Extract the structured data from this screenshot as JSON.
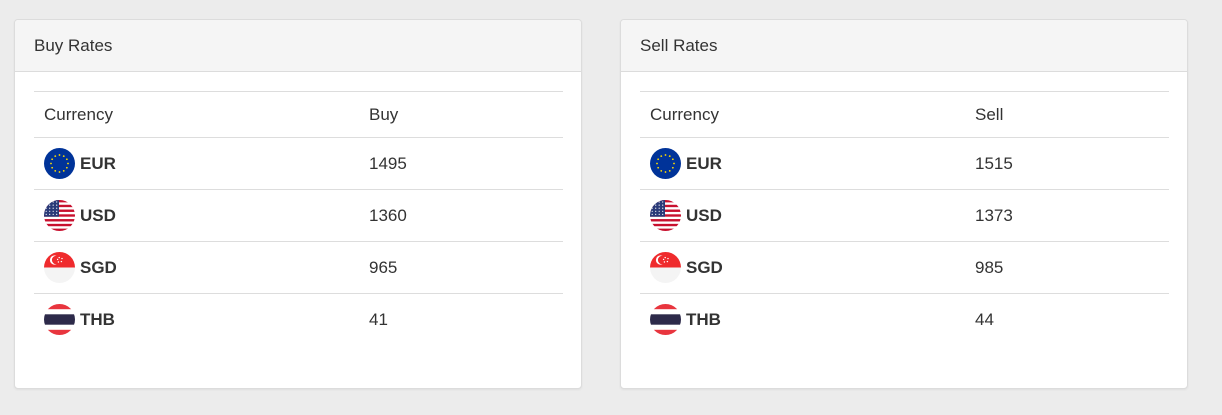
{
  "buy_panel": {
    "title": "Buy Rates",
    "headers": {
      "currency": "Currency",
      "value": "Buy"
    },
    "rows": [
      {
        "code": "EUR",
        "flag": "eu-flag-icon",
        "value": "1495"
      },
      {
        "code": "USD",
        "flag": "us-flag-icon",
        "value": "1360"
      },
      {
        "code": "SGD",
        "flag": "sg-flag-icon",
        "value": "965"
      },
      {
        "code": "THB",
        "flag": "th-flag-icon",
        "value": "41"
      }
    ]
  },
  "sell_panel": {
    "title": "Sell Rates",
    "headers": {
      "currency": "Currency",
      "value": "Sell"
    },
    "rows": [
      {
        "code": "EUR",
        "flag": "eu-flag-icon",
        "value": "1515"
      },
      {
        "code": "USD",
        "flag": "us-flag-icon",
        "value": "1373"
      },
      {
        "code": "SGD",
        "flag": "sg-flag-icon",
        "value": "985"
      },
      {
        "code": "THB",
        "flag": "th-flag-icon",
        "value": "44"
      }
    ]
  },
  "colors": {
    "background": "#ececec",
    "panel_heading": "#f5f5f5",
    "border": "#dddddd",
    "text": "#333333"
  }
}
